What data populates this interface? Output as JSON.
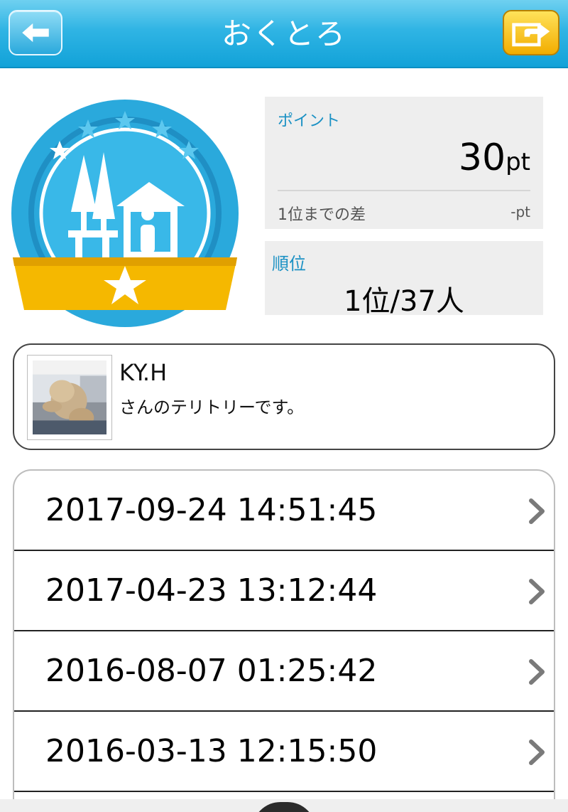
{
  "header": {
    "title": "おくとろ",
    "back_icon": "back-arrow-icon",
    "share_icon": "share-icon"
  },
  "badge": {
    "icon": "territory-badge-icon",
    "ring_color": "#2aa9dc",
    "ribbon_color": "#f5b800"
  },
  "points": {
    "label": "ポイント",
    "value": "30",
    "unit": "pt",
    "diff_label": "1位までの差",
    "diff_value": "-pt"
  },
  "rank": {
    "label": "順位",
    "value": "1位/37人"
  },
  "owner": {
    "name": "KY.H",
    "subtitle": "さんのテリトリーです。"
  },
  "history": [
    {
      "datetime": "2017-09-24 14:51:45"
    },
    {
      "datetime": "2017-04-23 13:12:44"
    },
    {
      "datetime": "2016-08-07 01:25:42"
    },
    {
      "datetime": "2016-03-13 12:15:50"
    }
  ],
  "colors": {
    "accent": "#1b91c4",
    "header": "#2fb4e4",
    "share": "#f2ad00"
  }
}
